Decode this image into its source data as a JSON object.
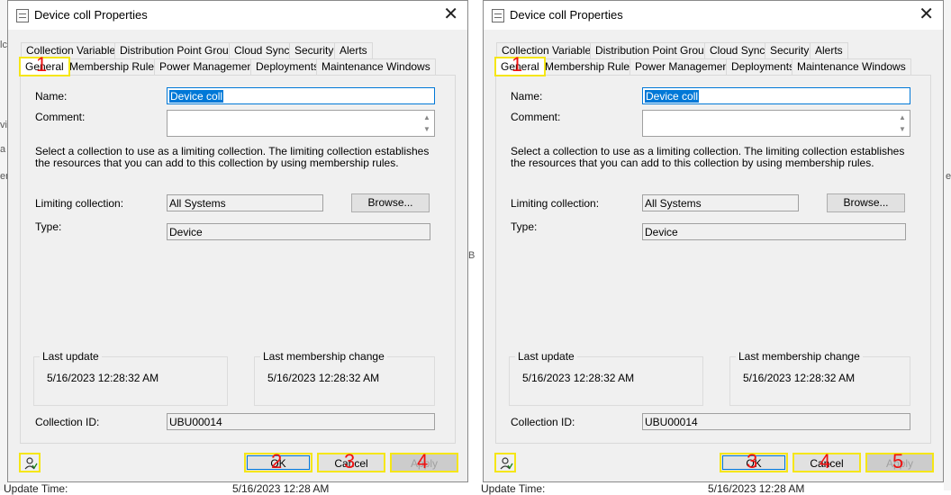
{
  "background": {
    "left_marks": [
      "lc",
      "vi",
      "a",
      "en",
      "lr"
    ],
    "right_marks": [
      "er",
      "B"
    ],
    "bottom_left": "Update Time:",
    "bottom_mid": "5/16/2023 12:28 AM",
    "bottom_right": "Update Time:",
    "bottom_far": "5/16/2023 12:28 AM"
  },
  "dialogs": [
    {
      "title": "Device coll Properties",
      "close": "✕",
      "tabs_row1": [
        "Collection Variables",
        "Distribution Point Groups",
        "Cloud Sync",
        "Security",
        "Alerts"
      ],
      "tabs_row2": [
        "General",
        "Membership Rules",
        "Power Management",
        "Deployments",
        "Maintenance Windows"
      ],
      "name_label": "Name:",
      "name_value": "Device coll",
      "comment_label": "Comment:",
      "description": "Select a collection to use as a limiting collection. The limiting collection establishes the resources that you can add to this collection by using membership rules.",
      "limiting_label": "Limiting collection:",
      "limiting_value": "All Systems",
      "browse": "Browse...",
      "type_label": "Type:",
      "type_value": "Device",
      "last_update_label": "Last update",
      "last_update_value": "5/16/2023 12:28:32 AM",
      "last_change_label": "Last membership change",
      "last_change_value": "5/16/2023 12:28:32 AM",
      "collection_id_label": "Collection ID:",
      "collection_id_value": "UBU00014",
      "ok": "OK",
      "cancel": "Cancel",
      "apply": "Apply",
      "markers": {
        "general": "1",
        "ok": "2",
        "cancel": "3",
        "apply": "4"
      }
    },
    {
      "title": "Device coll Properties",
      "close": "✕",
      "tabs_row1": [
        "Collection Variables",
        "Distribution Point Groups",
        "Cloud Sync",
        "Security",
        "Alerts"
      ],
      "tabs_row2": [
        "General",
        "Membership Rules",
        "Power Management",
        "Deployments",
        "Maintenance Windows"
      ],
      "name_label": "Name:",
      "name_value": "Device coll",
      "comment_label": "Comment:",
      "description": "Select a collection to use as a limiting collection. The limiting collection establishes the resources that you can add to this collection by using membership rules.",
      "limiting_label": "Limiting collection:",
      "limiting_value": "All Systems",
      "browse": "Browse...",
      "type_label": "Type:",
      "type_value": "Device",
      "last_update_label": "Last update",
      "last_update_value": "5/16/2023 12:28:32 AM",
      "last_change_label": "Last membership change",
      "last_change_value": "5/16/2023 12:28:32 AM",
      "collection_id_label": "Collection ID:",
      "collection_id_value": "UBU00014",
      "ok": "OK",
      "cancel": "Cancel",
      "apply": "Apply",
      "markers": {
        "general": "1",
        "ok": "3",
        "cancel": "4",
        "apply": "5"
      }
    }
  ]
}
